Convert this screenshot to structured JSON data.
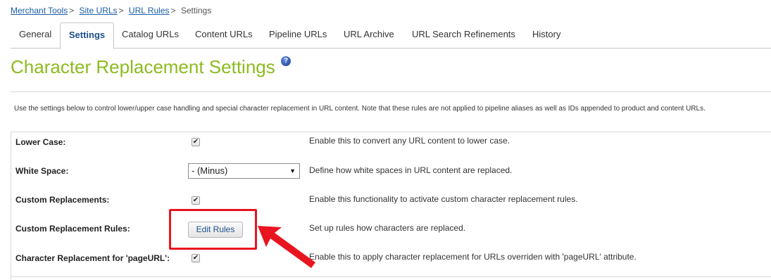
{
  "breadcrumb": {
    "items": [
      "Merchant Tools",
      "Site URLs",
      "URL Rules"
    ],
    "separator": ">",
    "current": "Settings"
  },
  "tabs": [
    "General",
    "Settings",
    "Catalog URLs",
    "Content URLs",
    "Pipeline URLs",
    "URL Archive",
    "URL Search Refinements",
    "History"
  ],
  "active_tab": "Settings",
  "page_title": "Character Replacement Settings",
  "help_icon_glyph": "?",
  "description": "Use the settings below to control lower/upper case handling and special character replacement in URL content. Note that these rules are not applied to pipeline aliases as well as IDs appended to product and content URLs.",
  "settings": {
    "lower_case": {
      "label": "Lower Case:",
      "checked": true,
      "description": "Enable this to convert any URL content to lower case."
    },
    "white_space": {
      "label": "White Space:",
      "value": "- (Minus)",
      "description": "Define how white spaces in URL content are replaced."
    },
    "custom_replacements": {
      "label": "Custom Replacements:",
      "checked": true,
      "description": "Enable this functionality to activate custom character replacement rules."
    },
    "custom_replacement_rules": {
      "label": "Custom Replacement Rules:",
      "button": "Edit Rules",
      "description": "Set up rules how characters are replaced."
    },
    "page_url": {
      "label": "Character Replacement for 'pageURL':",
      "checked": true,
      "description": "Enable this to apply character replacement for URLs overriden with 'pageURL' attribute."
    }
  },
  "colors": {
    "title": "#8dbb1f",
    "link": "#1a5ea6",
    "annotation": "#e8141f"
  },
  "icons": {
    "checkmark": "✔",
    "dropdown_arrow": "▼",
    "help": "help-icon"
  }
}
